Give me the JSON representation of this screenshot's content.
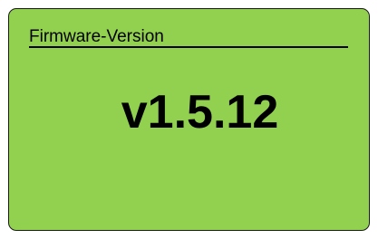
{
  "screen": {
    "header_label": "Firmware-Version",
    "value": "v1.5.12",
    "background_color": "#92d050",
    "text_color": "#000000"
  }
}
